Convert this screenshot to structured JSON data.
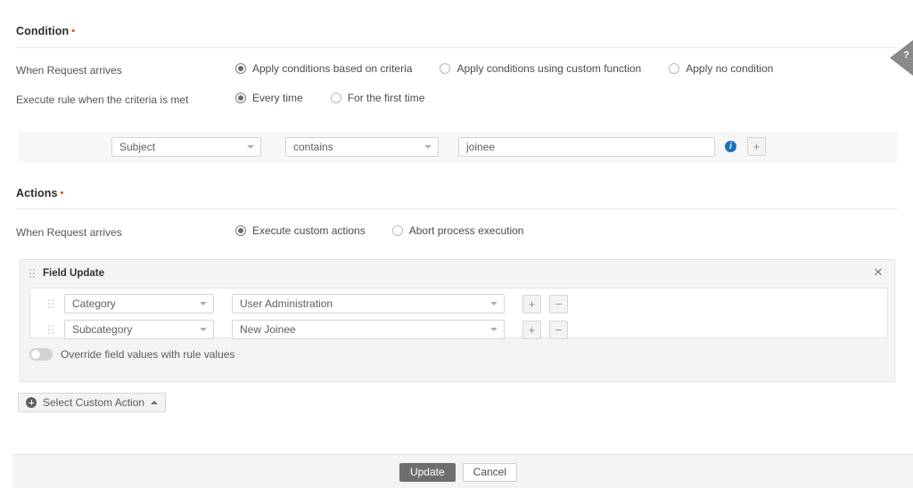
{
  "condition": {
    "title": "Condition",
    "required_marker": "•",
    "when_label": "When Request arrives",
    "when_options": [
      {
        "label": "Apply conditions based on criteria",
        "selected": true
      },
      {
        "label": "Apply conditions using custom function",
        "selected": false
      },
      {
        "label": "Apply no condition",
        "selected": false
      }
    ],
    "execute_label": "Execute rule when the criteria is met",
    "execute_options": [
      {
        "label": "Every time",
        "selected": true
      },
      {
        "label": "For the first time",
        "selected": false
      }
    ],
    "criteria": {
      "field": "Subject",
      "operator": "contains",
      "value": "joinee",
      "value_placeholder": "",
      "info_icon": "info-icon",
      "add_button": "+"
    }
  },
  "actions": {
    "title": "Actions",
    "required_marker": "•",
    "when_label": "When Request arrives",
    "when_options": [
      {
        "label": "Execute custom actions",
        "selected": true
      },
      {
        "label": "Abort process execution",
        "selected": false
      }
    ],
    "field_update": {
      "title": "Field Update",
      "drag_icon": "drag-handle-icon",
      "close_icon": "close-icon",
      "rows": [
        {
          "field": "Category",
          "value": "User Administration",
          "add_button": "+",
          "remove_button": "−"
        },
        {
          "field": "Subcategory",
          "value": "New Joinee",
          "add_button": "+",
          "remove_button": "−"
        }
      ],
      "override": {
        "label": "Override field values with rule values",
        "enabled": false
      }
    },
    "select_custom_action": {
      "label": "Select Custom Action",
      "plus_icon": "plus-circle-icon",
      "caret_icon": "caret-up-icon"
    }
  },
  "footer": {
    "update_label": "Update",
    "cancel_label": "Cancel"
  },
  "help_tab": {
    "label": "?",
    "icon": "question-mark-icon"
  },
  "colors": {
    "required": "#e8422f",
    "info": "#1a73c4",
    "primary_button": "#6e6e6e",
    "panel": "#f4f4f4"
  }
}
